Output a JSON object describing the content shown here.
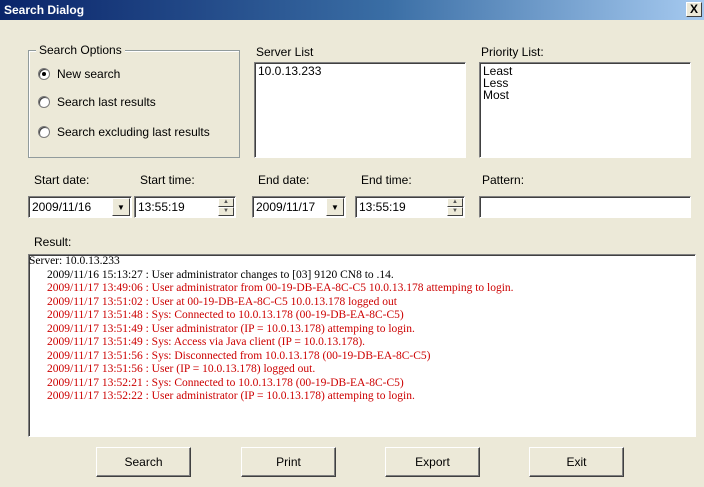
{
  "window": {
    "title": "Search Dialog",
    "close_label": "X"
  },
  "search_options": {
    "label": "Search Options",
    "options": [
      "New search",
      "Search last results",
      "Search excluding last results"
    ],
    "selected_index": 0
  },
  "server_list": {
    "label": "Server List",
    "items": [
      "10.0.13.233"
    ]
  },
  "priority_list": {
    "label": "Priority List:",
    "items": [
      "Least",
      "Less",
      "Most"
    ]
  },
  "start_date": {
    "label": "Start date:",
    "value": "2009/11/16"
  },
  "start_time": {
    "label": "Start time:",
    "value": "13:55:19"
  },
  "end_date": {
    "label": "End date:",
    "value": "2009/11/17"
  },
  "end_time": {
    "label": "End time:",
    "value": "13:55:19"
  },
  "pattern": {
    "label": "Pattern:",
    "value": ""
  },
  "result": {
    "label": "Result:",
    "colors": {
      "normal": "#000000",
      "alert": "#cc0000"
    },
    "lines": [
      {
        "text": "Server: 10.0.13.233",
        "color": "#000000",
        "indent": false
      },
      {
        "text": "2009/11/16 15:13:27 : User administrator changes to [03] 9120 CN8 to .14.",
        "color": "#000000",
        "indent": true
      },
      {
        "text": "2009/11/17 13:49:06 : User administrator from 00-19-DB-EA-8C-C5 10.0.13.178 attemping to login.",
        "color": "#cc0000",
        "indent": true
      },
      {
        "text": "2009/11/17 13:51:02 : User at 00-19-DB-EA-8C-C5 10.0.13.178 logged out",
        "color": "#cc0000",
        "indent": true
      },
      {
        "text": "2009/11/17 13:51:48 : Sys: Connected to 10.0.13.178 (00-19-DB-EA-8C-C5)",
        "color": "#cc0000",
        "indent": true
      },
      {
        "text": "2009/11/17 13:51:49 : User administrator (IP = 10.0.13.178) attemping to login.",
        "color": "#cc0000",
        "indent": true
      },
      {
        "text": "2009/11/17 13:51:49 : Sys: Access via Java client (IP = 10.0.13.178).",
        "color": "#cc0000",
        "indent": true
      },
      {
        "text": "2009/11/17 13:51:56 : Sys: Disconnected from 10.0.13.178 (00-19-DB-EA-8C-C5)",
        "color": "#cc0000",
        "indent": true
      },
      {
        "text": "2009/11/17 13:51:56 : User  (IP = 10.0.13.178) logged out.",
        "color": "#cc0000",
        "indent": true
      },
      {
        "text": "2009/11/17 13:52:21 : Sys: Connected to 10.0.13.178 (00-19-DB-EA-8C-C5)",
        "color": "#cc0000",
        "indent": true
      },
      {
        "text": "2009/11/17 13:52:22 : User administrator (IP = 10.0.13.178) attemping to login.",
        "color": "#cc0000",
        "indent": true
      }
    ]
  },
  "buttons": {
    "search": "Search",
    "print": "Print",
    "export": "Export",
    "exit": "Exit"
  }
}
